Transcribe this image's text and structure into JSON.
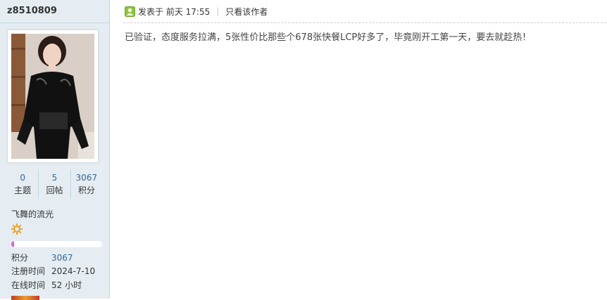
{
  "user": {
    "username": "z8510809",
    "avatar_alt": "avatar",
    "stats": [
      {
        "value": "0",
        "label": "主题"
      },
      {
        "value": "5",
        "label": "回帖"
      },
      {
        "value": "3067",
        "label": "积分"
      }
    ],
    "usergroup": "飞舞的流光",
    "level_icon": "sun-icon",
    "level_progress": 0.03,
    "info": [
      {
        "label": "积分",
        "value": "3067"
      },
      {
        "label": "注册时间",
        "value": "2024-7-10"
      },
      {
        "label": "在线时间",
        "value": "52 小时"
      }
    ]
  },
  "post": {
    "posted_at": "发表于 前天 17:55",
    "author_only": "只看该作者",
    "separator": "|",
    "content": "已验证，态度服务拉满，5张性价比那些个678张快餐LCP好多了，毕竟刚开工第一天，要去就趁热！"
  },
  "colors": {
    "sidebar_bg": "#e5edf2",
    "link": "#336699",
    "progress_fill": "#d462d4",
    "online_icon": "#8cc63f"
  }
}
